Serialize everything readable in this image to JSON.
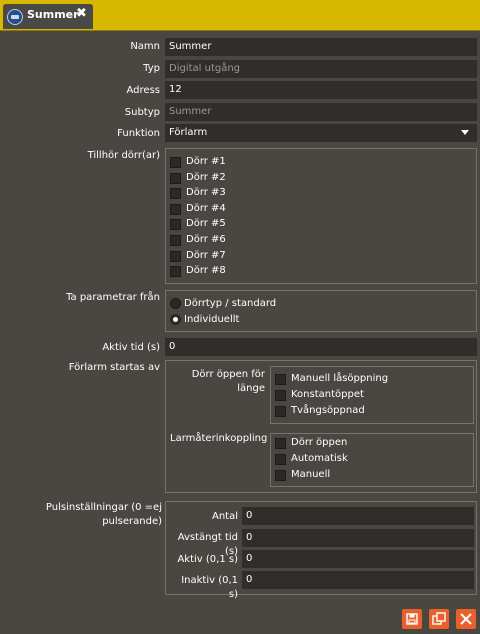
{
  "tab": {
    "title": "Summer",
    "close": "✖"
  },
  "form": {
    "namn": {
      "label": "Namn",
      "value": "Summer"
    },
    "typ": {
      "label": "Typ",
      "value": "Digital utgång"
    },
    "adress": {
      "label": "Adress",
      "value": "12"
    },
    "subtyp": {
      "label": "Subtyp",
      "placeholder": "Summer"
    },
    "funktion": {
      "label": "Funktion",
      "value": "Förlarm"
    },
    "tillhor": {
      "label": "Tillhör dörr(ar)",
      "doors": [
        "Dörr #1",
        "Dörr #2",
        "Dörr #3",
        "Dörr #4",
        "Dörr #5",
        "Dörr #6",
        "Dörr #7",
        "Dörr #8"
      ]
    },
    "param": {
      "label": "Ta parametrar från",
      "options": [
        "Dörrtyp / standard",
        "Individuellt"
      ],
      "selected": "Individuellt"
    },
    "aktiv_tid": {
      "label": "Aktiv tid (s)",
      "value": "0"
    },
    "forlarm": {
      "label": "Förlarm startas av",
      "door_open": {
        "label": "Dörr öppen för länge",
        "options": [
          "Manuell låsöppning",
          "Konstantöppet",
          "Tvångsöppnad"
        ]
      },
      "larm": {
        "label": "Larmåterinkoppling",
        "options": [
          "Dörr öppen",
          "Automatisk",
          "Manuell"
        ]
      }
    },
    "puls": {
      "label": "Pulsinställningar (0 =ej pulserande)",
      "antal": {
        "label": "Antal",
        "value": "0"
      },
      "avstangt": {
        "label": "Avstängt tid (s)",
        "value": "0"
      },
      "aktiv": {
        "label": "Aktiv (0,1 s)",
        "value": "0"
      },
      "inaktiv": {
        "label": "Inaktiv (0,1 s)",
        "value": "0"
      }
    }
  },
  "colors": {
    "accent": "#d6b800",
    "button": "#e8612c",
    "background": "#4a4742",
    "field": "#302e2b"
  },
  "icons": {
    "tab": "speaker-icon",
    "save": "save-icon",
    "copy": "copy-icon",
    "delete": "close-icon"
  }
}
